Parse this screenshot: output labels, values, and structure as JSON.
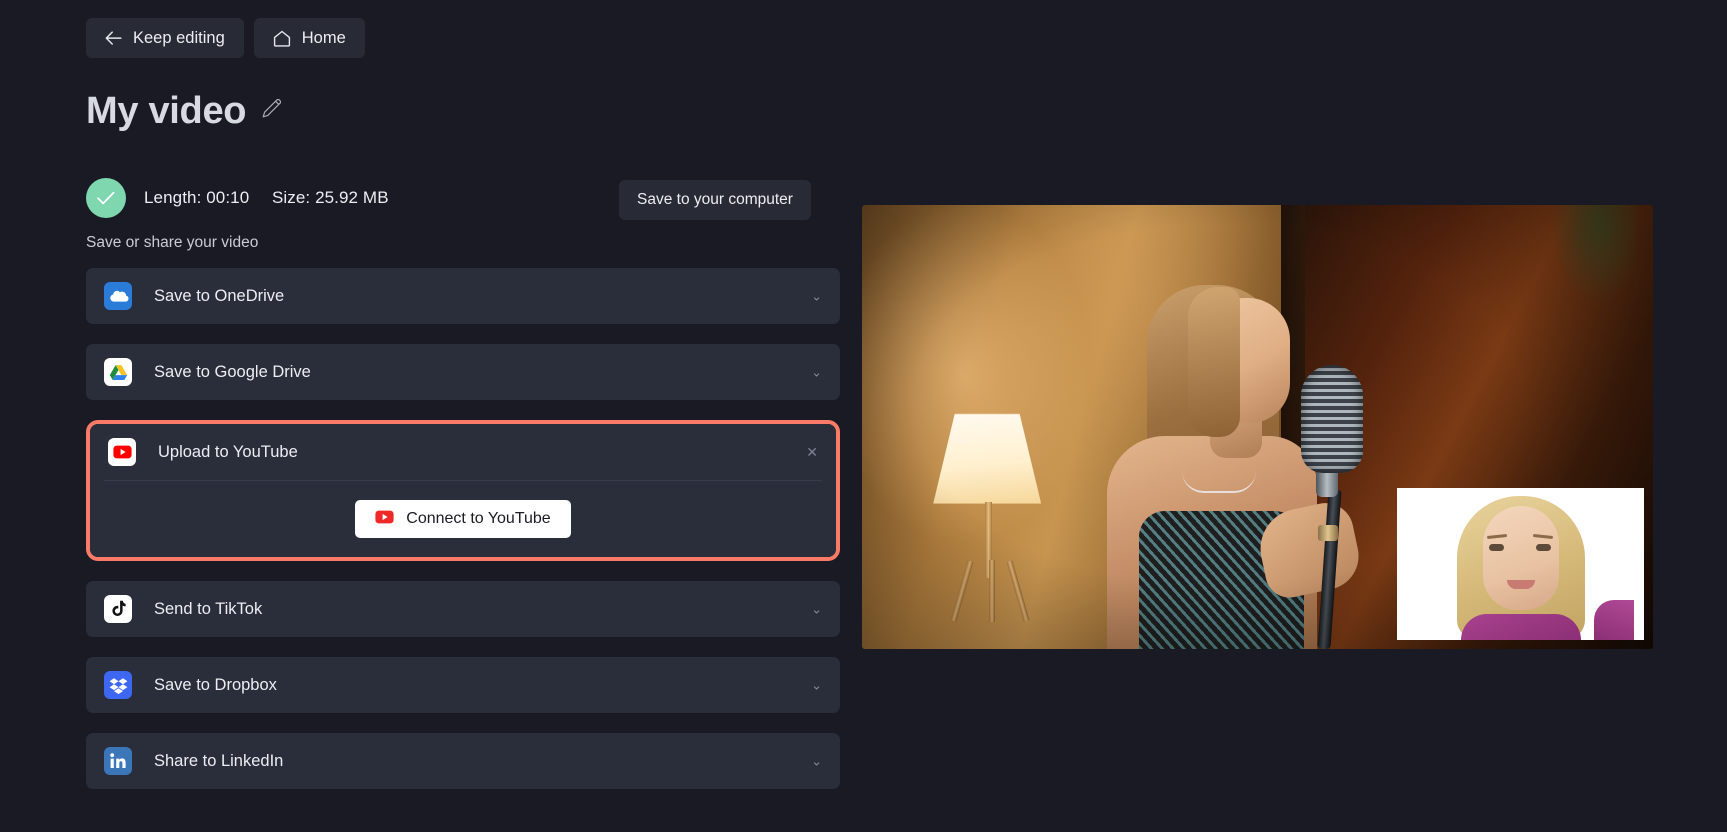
{
  "topbar": {
    "back_label": "Keep editing",
    "back_icon": "arrow-left-icon",
    "home_label": "Home",
    "home_icon": "home-icon"
  },
  "title": {
    "text": "My video",
    "edit_icon": "pencil-icon"
  },
  "status": {
    "check_icon": "checkmark-icon",
    "length_label": "Length: 00:10",
    "size_label": "Size: 25.92 MB",
    "save_computer_label": "Save to your computer"
  },
  "share": {
    "section_label": "Save or share your video",
    "chevron_icon": "chevron-down-icon",
    "close_icon": "close-icon",
    "rows": [
      {
        "label": "Save to OneDrive",
        "icon": "onedrive-icon"
      },
      {
        "label": "Save to Google Drive",
        "icon": "google-drive-icon"
      },
      {
        "label": "Send to TikTok",
        "icon": "tiktok-icon"
      },
      {
        "label": "Save to Dropbox",
        "icon": "dropbox-icon"
      },
      {
        "label": "Share to LinkedIn",
        "icon": "linkedin-icon"
      }
    ],
    "youtube": {
      "label": "Upload to YouTube",
      "icon": "youtube-icon",
      "connect_label": "Connect to YouTube",
      "connect_icon": "youtube-icon",
      "highlighted": true
    }
  },
  "preview": {
    "name": "video-preview",
    "pip_name": "picture-in-picture-overlay"
  },
  "colors": {
    "page_bg": "#191a23",
    "row_bg": "#2a2d3a",
    "button_bg": "#282a36",
    "highlight_border": "#fa7a68",
    "success_green": "#7fd7b0",
    "youtube_red": "#ff0000",
    "text": "#eceef3"
  }
}
